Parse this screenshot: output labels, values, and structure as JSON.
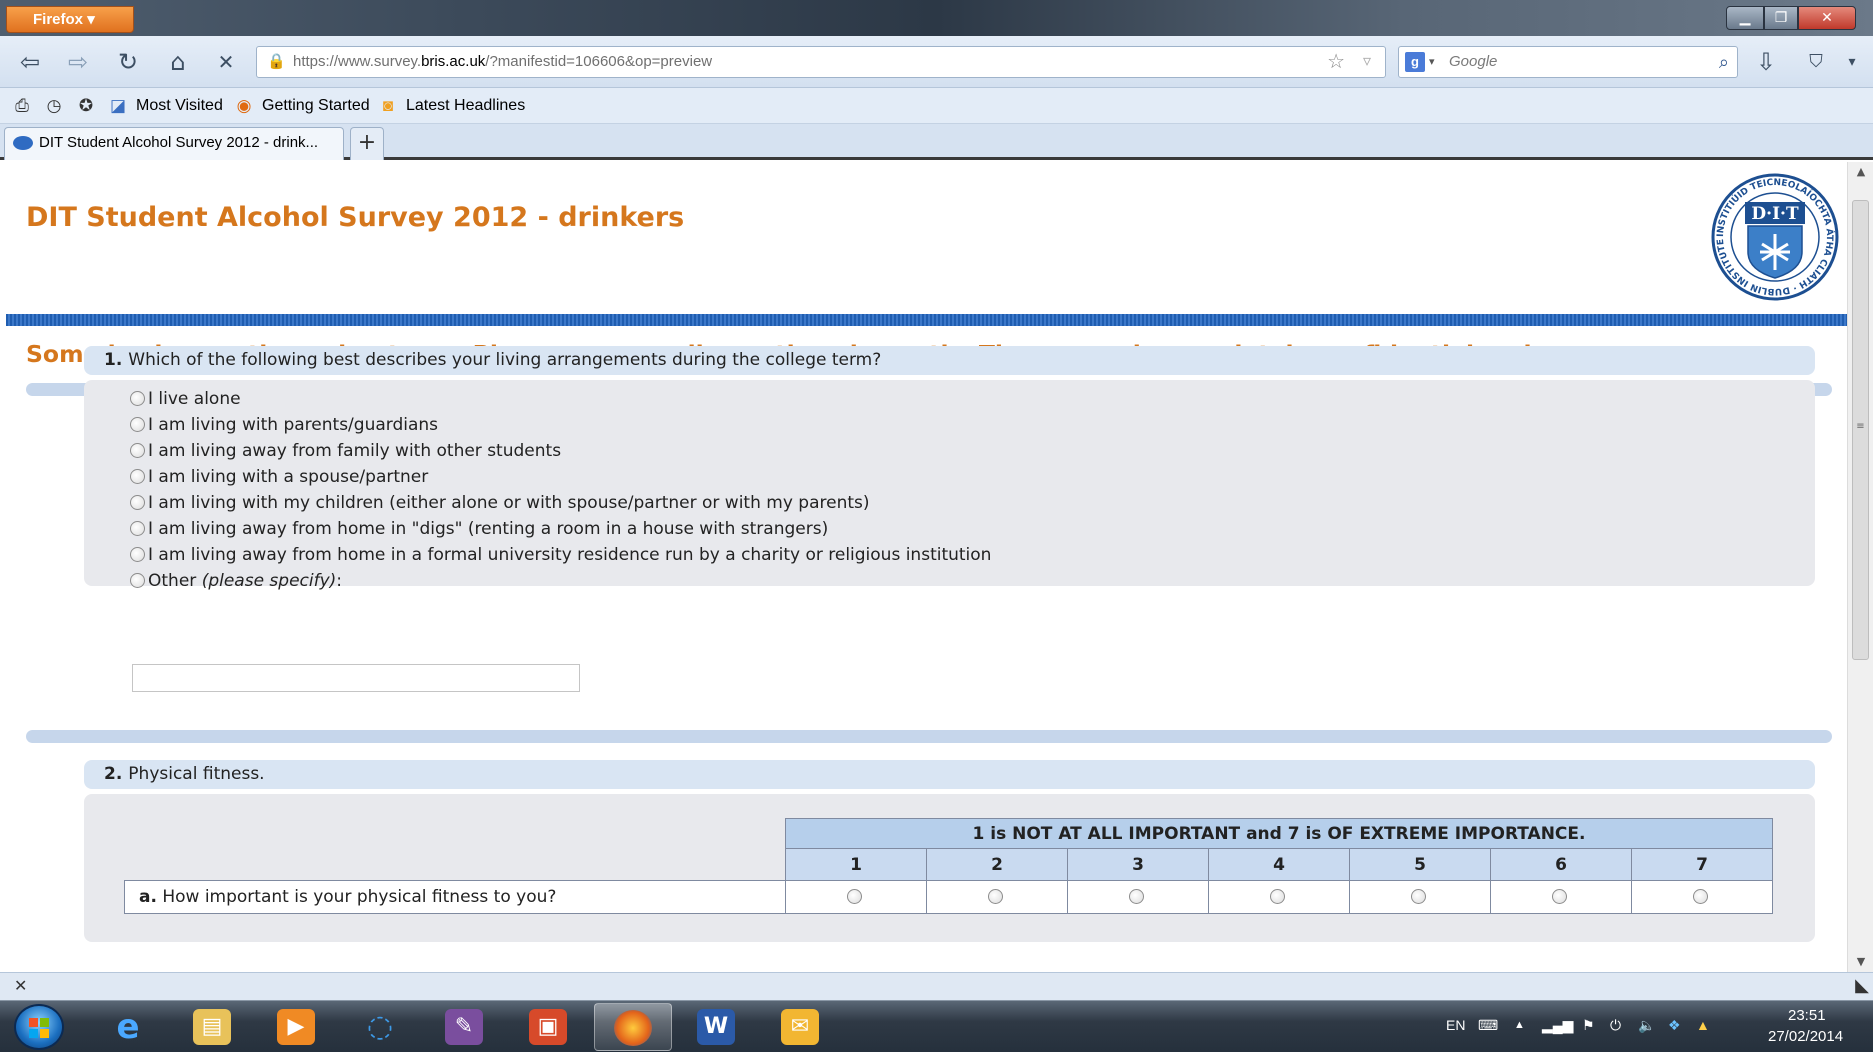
{
  "browser": {
    "menu_label": "Firefox",
    "window_controls": {
      "minimize_icon": "minimize-icon",
      "maximize_icon": "maximize-icon",
      "close_icon": "close-icon"
    },
    "url": {
      "prefix": "https://www.survey.",
      "host": "bris.ac.uk",
      "path": "/?manifestid=106606&op=preview"
    },
    "search_engine_icon": "google-g-icon",
    "search_placeholder": "Google",
    "bookmarks": [
      "Most Visited",
      "Getting Started",
      "Latest Headlines"
    ],
    "tab_title": "DIT Student Alcohol Survey 2012 - drink...",
    "new_tab_label": "+"
  },
  "page": {
    "title": "DIT Student Alcohol Survey 2012 - drinkers",
    "logo": {
      "ring_text": "INSTITIÚID TEICNEOLAÍOCHTA ÁTHA CLIATH · DUBLIN INSTITUTE of TECHNOLOGY ·",
      "letters": "D·I·T"
    },
    "section_intro": "Some basic questions about you. Please answer all questions honestly. The survey is completely confidential and anonymous."
  },
  "q1": {
    "number": "1.",
    "text": "Which of the following best describes your living arrangements during the college term?",
    "options": [
      "I live alone",
      "I am living with parents/guardians",
      "I am living away from family with other students",
      "I am living with a spouse/partner",
      "I am living with my children (either alone or with spouse/partner or with my parents)",
      "I am living away from home in \"digs\" (renting a room in a house with strangers)",
      "I am living away from home in a formal university residence run by a charity or religious institution"
    ],
    "other_label": "Other ",
    "other_hint": "(please specify)",
    "other_suffix": ":",
    "other_value": ""
  },
  "q2": {
    "number": "2.",
    "text": "Physical fitness.",
    "scale_caption": "1 is NOT AT ALL IMPORTANT and 7 is OF EXTREME IMPORTANCE.",
    "scale": [
      "1",
      "2",
      "3",
      "4",
      "5",
      "6",
      "7"
    ],
    "items": [
      {
        "letter": "a.",
        "text": "How important is your physical fitness to you?"
      }
    ]
  },
  "taskbar": {
    "apps": [
      "internet-explorer-icon",
      "file-explorer-icon",
      "media-player-icon",
      "sync-icon",
      "paint-icon",
      "camtasia-icon",
      "firefox-icon",
      "word-icon",
      "outlook-icon"
    ],
    "language": "EN",
    "time": "23:51",
    "date": "27/02/2014"
  },
  "colors": {
    "accent_orange": "#d5771d",
    "header_rule_blue": "#1f5db0",
    "question_header": "#d9e5f3",
    "question_body": "#e8e9ed"
  }
}
